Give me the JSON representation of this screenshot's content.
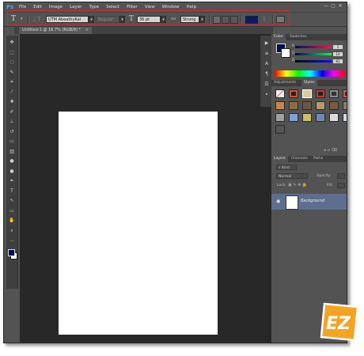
{
  "app": {
    "logo": "Ps"
  },
  "menubar": {
    "items": [
      "File",
      "Edit",
      "Image",
      "Layer",
      "Type",
      "Select",
      "Filter",
      "View",
      "Window",
      "Help"
    ],
    "controls": [
      "—",
      "▢",
      "✕"
    ]
  },
  "options_bar": {
    "font_family": "UTM AbeathyKai",
    "font_style": "Regular",
    "font_size": "36 pt",
    "aa_label": "aa",
    "antialias": "Strong",
    "text_color": "#0a1a6a"
  },
  "document_tab": {
    "title": "Untitled-1 @ 16.7% (RGB/8) *",
    "close": "×"
  },
  "tools": [
    {
      "name": "move-tool",
      "glyph": "✥"
    },
    {
      "name": "marquee-tool",
      "glyph": "⬚"
    },
    {
      "name": "lasso-tool",
      "glyph": "◌"
    },
    {
      "name": "quick-select-tool",
      "glyph": "✎"
    },
    {
      "name": "crop-tool",
      "glyph": "⌗"
    },
    {
      "name": "eyedropper-tool",
      "glyph": "⁄"
    },
    {
      "name": "spot-heal-tool",
      "glyph": "✚"
    },
    {
      "name": "brush-tool",
      "glyph": "✐"
    },
    {
      "name": "clone-stamp-tool",
      "glyph": "⊥"
    },
    {
      "name": "history-brush-tool",
      "glyph": "↺"
    },
    {
      "name": "eraser-tool",
      "glyph": "▭"
    },
    {
      "name": "gradient-tool",
      "glyph": "▥"
    },
    {
      "name": "blur-tool",
      "glyph": "●"
    },
    {
      "name": "dodge-tool",
      "glyph": "●"
    },
    {
      "name": "pen-tool",
      "glyph": "✒"
    },
    {
      "name": "type-tool",
      "glyph": "T"
    },
    {
      "name": "path-select-tool",
      "glyph": "↖"
    },
    {
      "name": "shape-tool",
      "glyph": "▭"
    },
    {
      "name": "hand-tool",
      "glyph": "✋"
    },
    {
      "name": "zoom-tool",
      "glyph": "⌕"
    },
    {
      "name": "extra-tool",
      "glyph": "…"
    }
  ],
  "right_icons": [
    "▶",
    "≡",
    "A",
    "¶",
    "☰",
    "⌖"
  ],
  "color_panel": {
    "tabs": [
      "Color",
      "Swatches"
    ],
    "channels": [
      {
        "label": "R",
        "value": "1"
      },
      {
        "label": "G",
        "value": "14"
      },
      {
        "label": "B",
        "value": "81"
      }
    ],
    "foreground": "#010e51"
  },
  "styles_panel": {
    "tabs": [
      "Adjustments",
      "Styles"
    ]
  },
  "layers_panel": {
    "tabs": [
      "Layers",
      "Channels",
      "Paths"
    ],
    "kind": "Kind",
    "blend_mode": "Normal",
    "opacity_label": "Opacity:",
    "lock_label": "Lock:",
    "fill_label": "Fill:",
    "layer_name": "Background"
  }
}
